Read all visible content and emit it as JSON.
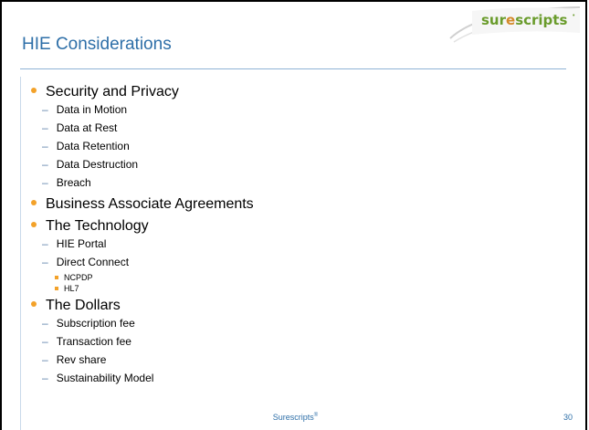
{
  "logo": {
    "part1": "sur",
    "part2": "e",
    "part3": "scripts",
    "mark": "•"
  },
  "title": "HIE Considerations",
  "items": [
    {
      "text": "Security and Privacy",
      "children": [
        "Data in Motion",
        "Data at Rest",
        "Data Retention",
        "Data Destruction",
        "Breach"
      ]
    },
    {
      "text": "Business Associate Agreements",
      "children": []
    },
    {
      "text": "The Technology",
      "children": [
        "HIE Portal",
        "Direct Connect"
      ],
      "subchildren": [
        "NCPDP",
        "HL7"
      ]
    },
    {
      "text": "The Dollars",
      "children": [
        "Subscription fee",
        "Transaction fee",
        "Rev share",
        "Sustainability Model"
      ]
    }
  ],
  "footer": {
    "brand": "Surescripts",
    "reg": "®",
    "page": "30"
  },
  "colors": {
    "title": "#2e6fa8",
    "bullet": "#f3a22a",
    "logo_green": "#6a9c2c",
    "logo_orange": "#d4892a"
  }
}
